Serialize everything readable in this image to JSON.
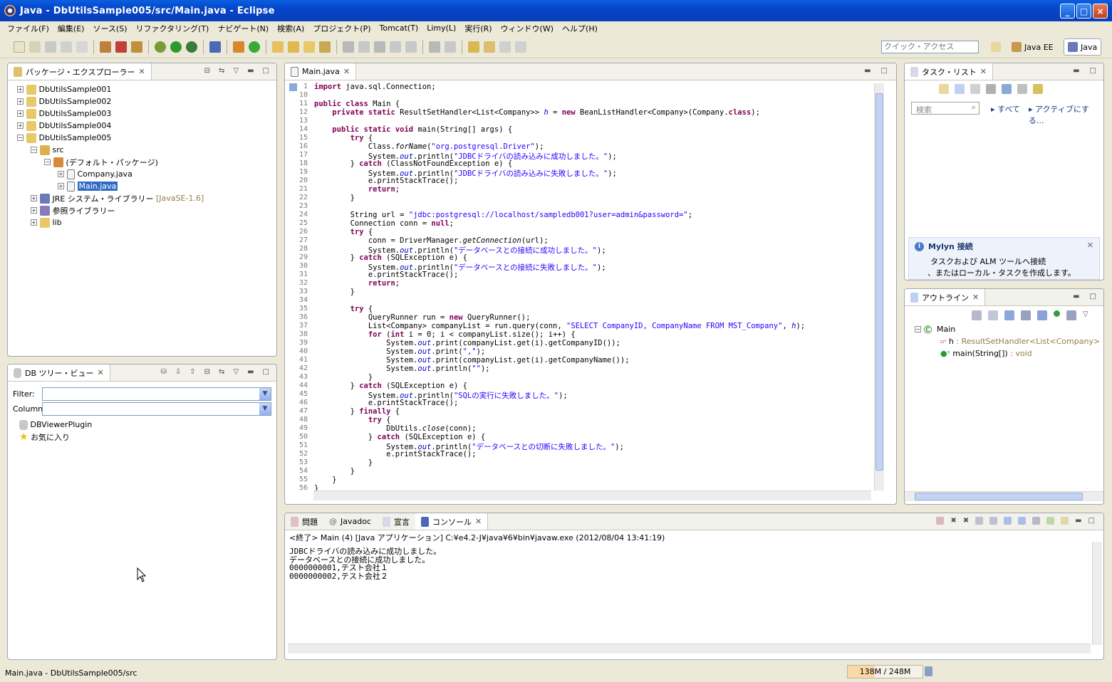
{
  "window": {
    "title": "Java - DbUtilsSample005/src/Main.java - Eclipse"
  },
  "menu": [
    "ファイル(F)",
    "編集(E)",
    "ソース(S)",
    "リファクタリング(T)",
    "ナビゲート(N)",
    "検索(A)",
    "プロジェクト(P)",
    "Tomcat(T)",
    "Limy(L)",
    "実行(R)",
    "ウィンドウ(W)",
    "ヘルプ(H)"
  ],
  "toolbar": {
    "quick_access_placeholder": "クイック・アクセス",
    "persp_javaee": "Java EE",
    "persp_java": "Java"
  },
  "package_explorer": {
    "tab": "パッケージ・エクスプローラー",
    "projects": [
      "DbUtilsSample001",
      "DbUtilsSample002",
      "DbUtilsSample003",
      "DbUtilsSample004",
      "DbUtilsSample005"
    ],
    "src": "src",
    "default_pkg": "(デフォルト・パッケージ)",
    "files": [
      "Company.java",
      "Main.java"
    ],
    "jre": "JRE システム・ライブラリー",
    "jre_version": "[JavaSE-1.6]",
    "ref_lib": "参照ライブラリー",
    "lib": "lib"
  },
  "db_tree": {
    "tab": "DB ツリー・ビュー",
    "filter_label": "Filter:",
    "column_label": "Column:",
    "items": [
      "DBViewerPlugin",
      "お気に入り"
    ]
  },
  "editor": {
    "tab": "Main.java",
    "line_numbers": [
      "1",
      "10",
      "11",
      "12",
      "13",
      "14",
      "15",
      "16",
      "17",
      "18",
      "19",
      "20",
      "21",
      "22",
      "23",
      "24",
      "25",
      "26",
      "27",
      "28",
      "29",
      "30",
      "31",
      "32",
      "33",
      "34",
      "35",
      "36",
      "37",
      "38",
      "39",
      "40",
      "41",
      "42",
      "43",
      "44",
      "45",
      "46",
      "47",
      "48",
      "49",
      "50",
      "51",
      "52",
      "53",
      "54",
      "55",
      "56"
    ]
  },
  "tasks": {
    "tab": "タスク・リスト",
    "search_placeholder": "検索",
    "all": "すべて",
    "active": "アクティブにする...",
    "mylyn_title": "Mylyn 接続",
    "mylyn_line1": "タスクおよび ALM ツールへ接続",
    "mylyn_line2": "、またはローカル・タスクを作成します。"
  },
  "outline": {
    "tab": "アウトライン",
    "class": "Main",
    "field": "h",
    "field_type": ": ResultSetHandler<List<Company>",
    "method": "main(String[])",
    "method_type": ": void"
  },
  "bottom": {
    "tabs": [
      "問題",
      "Javadoc",
      "宣言",
      "コンソール"
    ],
    "header": "<終了> Main (4) [Java アプリケーション] C:¥e4.2-J¥java¥6¥bin¥javaw.exe (2012/08/04 13:41:19)",
    "lines": [
      "JDBCドライバの読み込みに成功しました。",
      "データベースとの接続に成功しました。",
      "0000000001,テスト会社１",
      "0000000002,テスト会社２"
    ]
  },
  "status": {
    "text": "Main.java - DbUtilsSample005/src",
    "memory": "138M / 248M"
  },
  "colors": {
    "keyword": "#7f0055",
    "string": "#2a00ff",
    "field": "#0000c0",
    "selection": "#316ac5",
    "titlebar": "#0545c9"
  }
}
